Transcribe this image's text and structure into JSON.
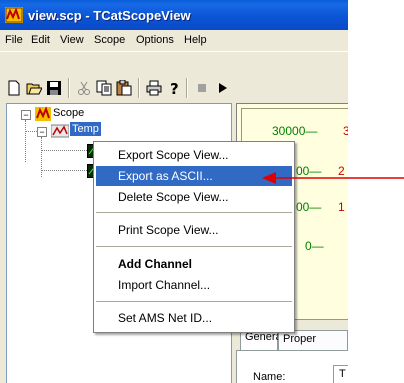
{
  "window": {
    "title": "view.scp - TCatScopeView"
  },
  "menubar": {
    "items": [
      "File",
      "Edit",
      "View",
      "Scope",
      "Options",
      "Help"
    ]
  },
  "toolbar": {
    "icons": [
      "new-icon",
      "open-icon",
      "save-icon",
      "cut-icon",
      "copy-icon",
      "paste-icon",
      "print-icon",
      "help-icon",
      "stop-icon",
      "play-icon"
    ]
  },
  "tree": {
    "root_label": "Scope",
    "child_label": "Temp",
    "expander_minus": "−"
  },
  "context_menu": {
    "items": [
      {
        "label": "Export Scope View...",
        "highlighted": false,
        "bold": false
      },
      {
        "label": "Export as ASCII...",
        "highlighted": true,
        "bold": false
      },
      {
        "label": "Delete Scope View...",
        "highlighted": false,
        "bold": false
      },
      {
        "label": "Print Scope View...",
        "highlighted": false,
        "bold": false
      },
      {
        "label": "Add Channel",
        "highlighted": false,
        "bold": true
      },
      {
        "label": "Import Channel...",
        "highlighted": false,
        "bold": false
      },
      {
        "label": "Set AMS Net ID...",
        "highlighted": false,
        "bold": false
      }
    ]
  },
  "chart_area": {
    "y_ticks_left": [
      "30000—",
      "00—",
      "00—",
      "0—"
    ],
    "y_ticks_right": [
      "3",
      "2",
      "1"
    ]
  },
  "properties": {
    "tabs": [
      "General",
      "Proper"
    ],
    "name_label": "Name:",
    "name_value": "T"
  },
  "colors": {
    "titlebar": "#0a55d6",
    "highlight": "#316ac5",
    "tick_green": "#008000",
    "annotation_arrow": "#e00000"
  }
}
